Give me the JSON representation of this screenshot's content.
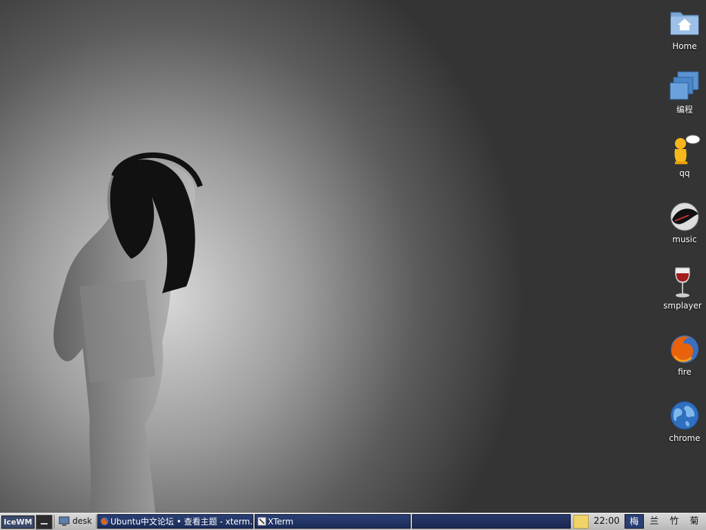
{
  "desktop_icons": [
    {
      "label": "Home",
      "icon": "home-folder-icon"
    },
    {
      "label": "编程",
      "icon": "windows-stack-icon"
    },
    {
      "label": "qq",
      "icon": "qq-penguin-icon"
    },
    {
      "label": "music",
      "icon": "orca-music-icon"
    },
    {
      "label": "smplayer",
      "icon": "wine-glass-icon"
    },
    {
      "label": "fire",
      "icon": "firefox-icon"
    },
    {
      "label": "chrome",
      "icon": "globe-icon"
    }
  ],
  "taskbar": {
    "start_label": "IceWM",
    "show_desktop_label": "desk",
    "tasks": [
      {
        "label": "Ubuntu中文论坛 • 查看主题 - xterm...",
        "icon": "firefox-icon"
      },
      {
        "label": "XTerm",
        "icon": "terminal-icon"
      }
    ],
    "clock": "22:00",
    "workspaces": [
      "梅",
      "兰",
      "竹",
      "菊"
    ],
    "active_workspace": "梅"
  },
  "colors": {
    "taskbar_bg": "#c8c8c8",
    "task_active": "#2a3f74",
    "desktop_text": "#ffffff"
  }
}
